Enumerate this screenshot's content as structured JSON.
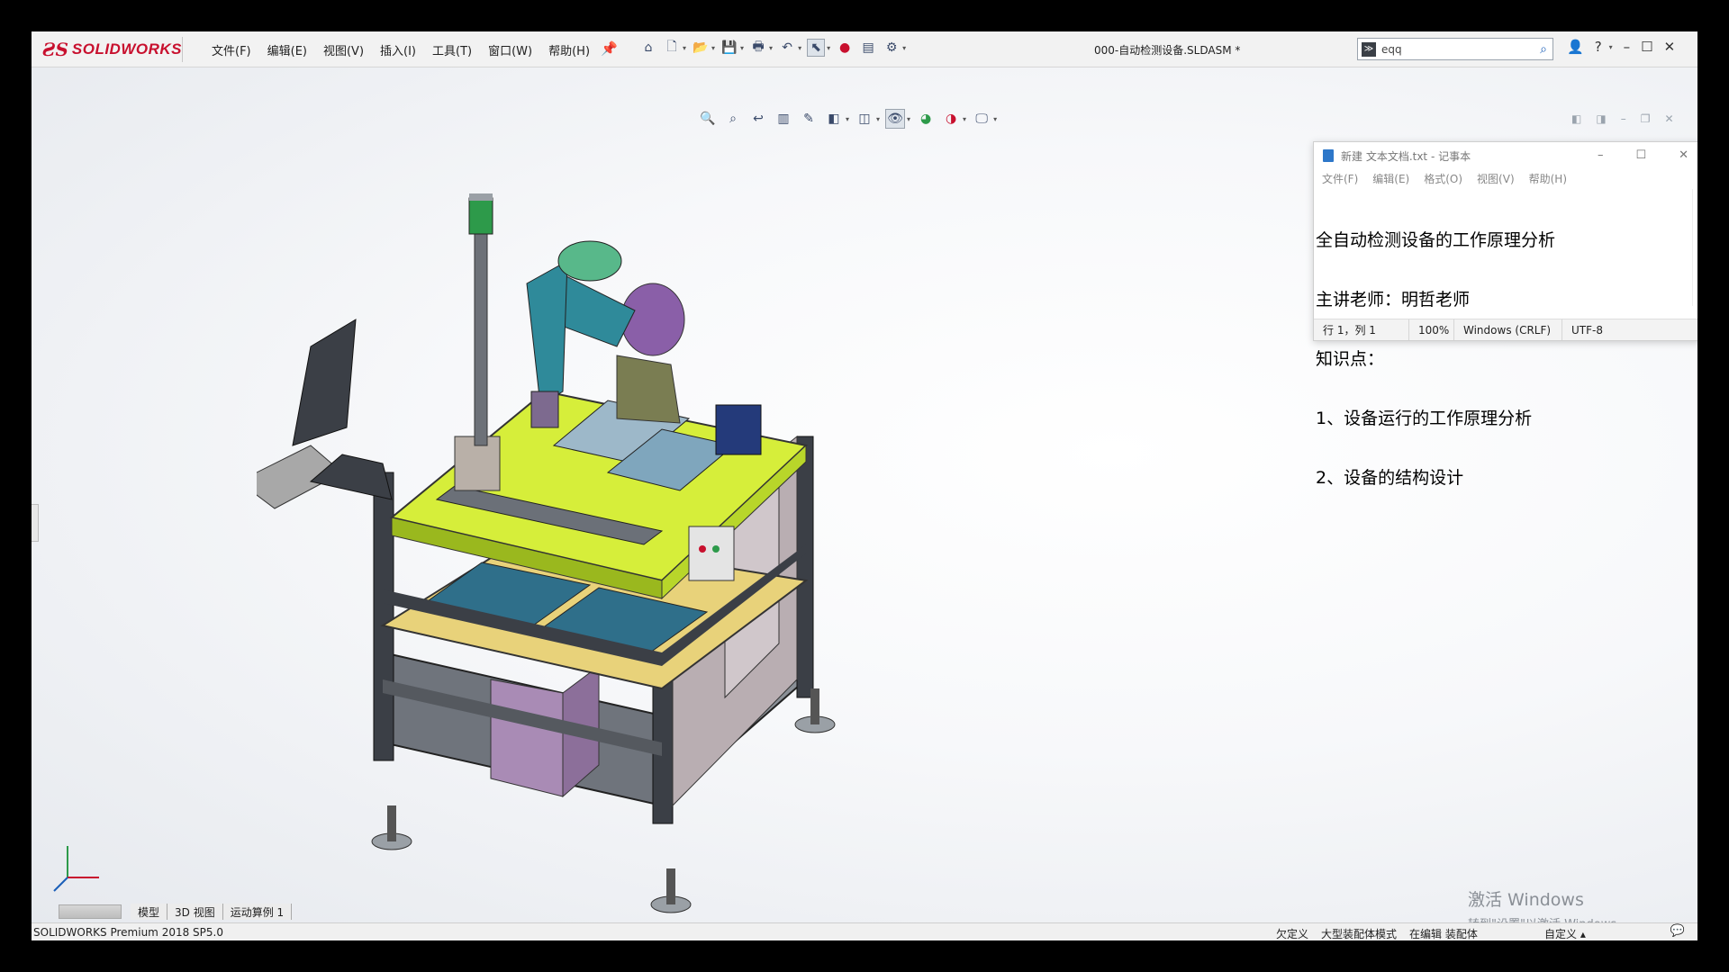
{
  "brand": {
    "logo_mark": "ƧS",
    "logo_text": "SOLIDWORKS"
  },
  "menu": [
    "文件(F)",
    "编辑(E)",
    "视图(V)",
    "插入(I)",
    "工具(T)",
    "窗口(W)",
    "帮助(H)"
  ],
  "document_title": "000-自动检测设备.SLDASM *",
  "search": {
    "value": "eqq"
  },
  "notepad": {
    "title": "新建 文本文档.txt - 记事本",
    "menu": [
      "文件(F)",
      "编辑(E)",
      "格式(O)",
      "视图(V)",
      "帮助(H)"
    ],
    "lines": [
      "全自动检测设备的工作原理分析",
      "主讲老师：明哲老师",
      "知识点：",
      "1、设备运行的工作原理分析",
      "2、设备的结构设计"
    ],
    "status": {
      "position": "行 1，列 1",
      "zoom": "100%",
      "line_ending": "Windows (CRLF)",
      "encoding": "UTF-8"
    }
  },
  "watermark": {
    "line1": "激活 Windows",
    "line2": "转到\"设置\"以激活 Windows。"
  },
  "tabs": [
    "模型",
    "3D 视图",
    "运动算例 1"
  ],
  "status": {
    "version": "SOLIDWORKS Premium 2018 SP5.0",
    "right_items": [
      "欠定义",
      "大型装配体模式",
      "在编辑 装配体"
    ],
    "custom": "自定义"
  },
  "colors": {
    "brand_red": "#c8102e",
    "table_top": "#d6ee3a",
    "frame": "#3b3f46",
    "robot_teal": "#2f8a9a",
    "robot_purple": "#8a5fa8"
  }
}
